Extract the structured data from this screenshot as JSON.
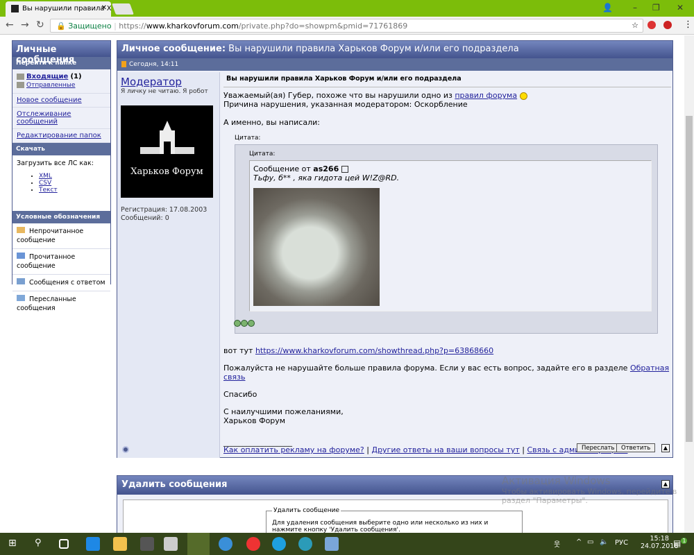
{
  "browser": {
    "tab_title": "Вы нарушили правила X",
    "secure_label": "Защищено",
    "url_scheme": "https://",
    "url_domain": "www.kharkovforum.com",
    "url_path": "/private.php?do=showpm&pmid=71761869"
  },
  "sidebar": {
    "title": "Личные сообщения",
    "goto_header": "Перейти к папке",
    "inbox": "Входящие",
    "inbox_count": "(1)",
    "sent": "Отправленные",
    "links": [
      "Новое сообщение",
      "Отслеживание сообщений",
      "Редактирование папок"
    ],
    "download_header": "Скачать",
    "download_label": "Загрузить все ЛС как:",
    "formats": [
      "XML",
      "CSV",
      "Текст"
    ],
    "legend_header": "Условные обозначения",
    "legend": [
      "Непрочитанное сообщение",
      "Прочитанное сообщение",
      "Сообщения с ответом",
      "Пересланные сообщения"
    ]
  },
  "message": {
    "title_prefix": "Личное сообщение:",
    "title": "Вы нарушили правила Харьков Форум и/или его подраздела",
    "date": "Сегодня, 14:11",
    "author": "Модератор",
    "author_title": "Я личку не читаю. Я робот",
    "avatar_text": "Харьков Форум",
    "registration": "Регистрация: 17.08.2003",
    "posts": "Сообщений: 0",
    "subject": "Вы нарушили правила Харьков Форум и/или его подраздела",
    "greeting": "Уважаемый(ая) Губер, похоже что вы нарушили одно из ",
    "rules_link": "правил форума",
    "reason": "Причина нарушения, указанная модератором: Оскорбление",
    "you_wrote": "А именно, вы написали:",
    "quote_label": "Цитата:",
    "inner_quote_label": "Цитата:",
    "quote_from": "Сообщение от ",
    "quote_user": "as266",
    "quote_text": "Тьфу, б** , яка гидота цей W!Z@RD.",
    "here": "вот тут ",
    "thread_link": "https://www.kharkovforum.com/showthread.php?p=63868660",
    "please": "Пожалуйста не нарушайте больше правила форума. Если у вас есть вопрос, задайте его в разделе ",
    "feedback_link": "Обратная связь",
    "thanks": "Спасибо",
    "regards": "С наилучшими пожеланиями,",
    "signature": "Харьков Форум",
    "separator": "__________________",
    "sig_links": [
      "Как оплатить рекламу на форуме?",
      "Другие ответы на ваши вопросы тут",
      "Связь с администрацией"
    ],
    "forward_btn": "Переслать",
    "reply_btn": "Ответить"
  },
  "delete": {
    "title": "Удалить сообщения",
    "legend": "Удалить сообщение",
    "text": "Для удаления сообщения выберите одно или несколько из них и нажмите кнопку 'Удалить сообщения'."
  },
  "watermark": {
    "title": "Активация Windows",
    "text1": "Чтобы активировать Windows, перейдите в",
    "text2": "раздел \"Параметры\"."
  },
  "taskbar": {
    "lang": "РУС",
    "time": "15:18",
    "date": "24.07.2018",
    "notif_count": "1"
  }
}
